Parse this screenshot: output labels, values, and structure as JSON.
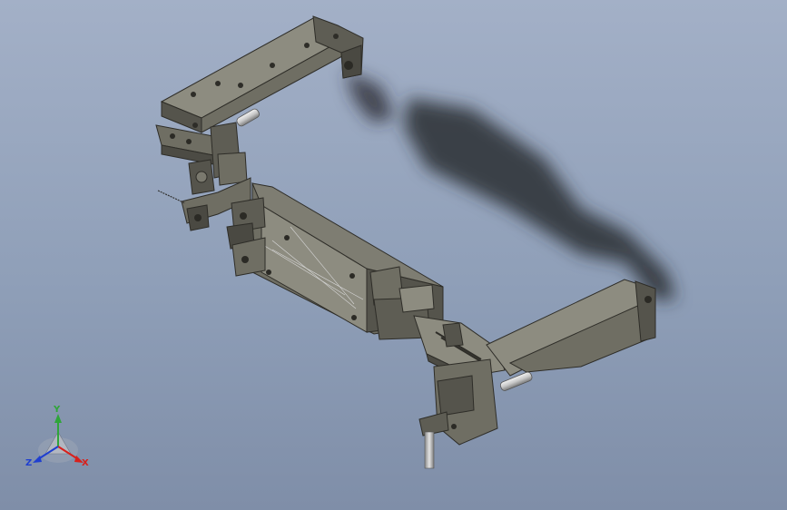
{
  "viewport": {
    "background_top": "#a3b0c7",
    "background_bottom": "#7f8ea8"
  },
  "model": {
    "part_color": "#6f6e63",
    "part_dark": "#3f3e37",
    "part_light": "#8d8c80"
  },
  "triad": {
    "x_label": "X",
    "y_label": "Y",
    "z_label": "Z",
    "x_color": "#d8201c",
    "y_color": "#2fa53a",
    "z_color": "#1f3fd0"
  }
}
